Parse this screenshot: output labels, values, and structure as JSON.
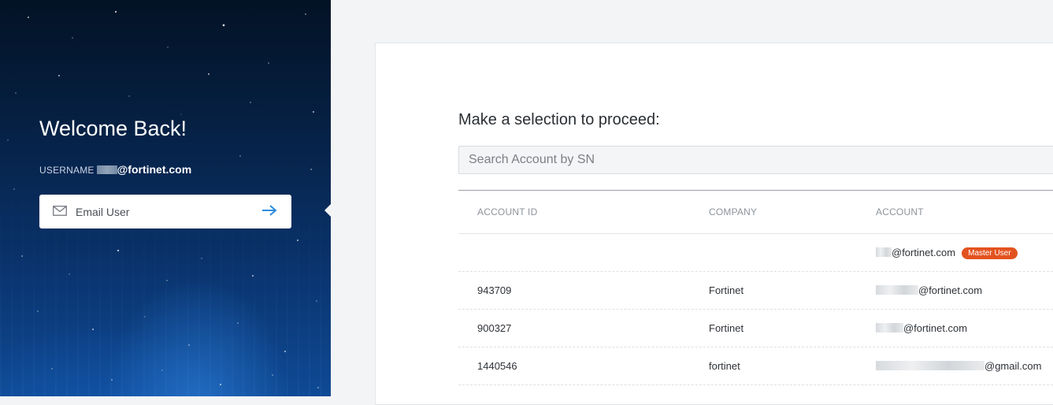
{
  "login": {
    "welcome_title": "Welcome Back!",
    "username_label": "USERNAME",
    "username_value": "@fortinet.com",
    "email_button_label": "Email User"
  },
  "selection": {
    "title": "Make a selection to proceed:",
    "search_placeholder": "Search Account by SN"
  },
  "table": {
    "columns": [
      "ACCOUNT ID",
      "COMPANY",
      "ACCOUNT"
    ],
    "rows": [
      {
        "account_id": "",
        "company": "",
        "account": "@fortinet.com",
        "badge": "Master User"
      },
      {
        "account_id": "943709",
        "company": "Fortinet",
        "account": "@fortinet.com"
      },
      {
        "account_id": "900327",
        "company": "Fortinet",
        "account": "@fortinet.com"
      },
      {
        "account_id": "1440546",
        "company": "fortinet",
        "account": "@gmail.com"
      }
    ]
  },
  "colors": {
    "badge": "#e2531f",
    "arrow_accent": "#2b8ce0",
    "panel_dark": "#062247"
  }
}
